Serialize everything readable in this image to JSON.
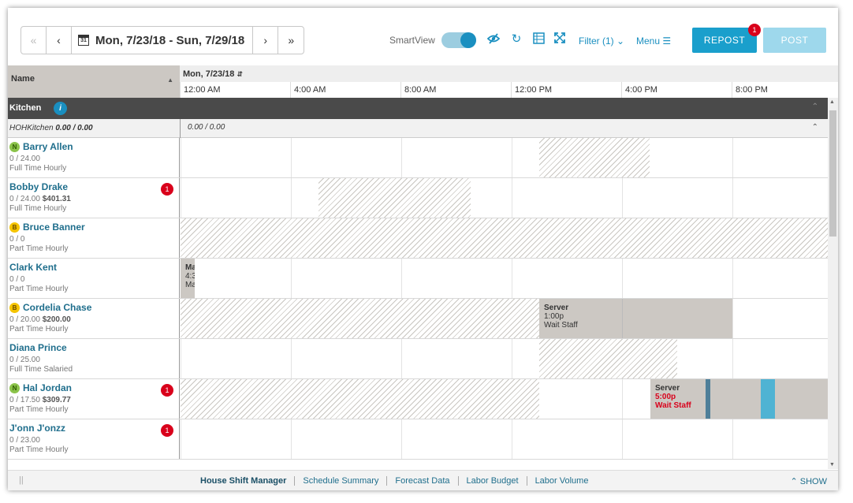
{
  "toolbar": {
    "date_range": "Mon, 7/23/18 - Sun, 7/29/18",
    "calendar_day": "31",
    "smartview_label": "SmartView",
    "filter_label": "Filter (1)",
    "menu_label": "Menu",
    "repost_label": "REPOST",
    "repost_badge": "1",
    "post_label": "POST"
  },
  "grid": {
    "name_header": "Name",
    "date_header": "Mon, 7/23/18",
    "ticks": [
      "12:00 AM",
      "4:00 AM",
      "8:00 AM",
      "12:00 PM",
      "4:00 PM",
      "8:00 PM"
    ]
  },
  "group": {
    "name": "Kitchen",
    "info": "i",
    "sub_label": "HOHKitchen",
    "sub_hours": "0.00 / 0.00",
    "sub_hours_right": "0.00 / 0.00"
  },
  "employees": [
    {
      "name": "Barry Allen",
      "tag": "N",
      "hours": "0 / 24.00",
      "cost": "",
      "type": "Full Time Hourly",
      "badge": ""
    },
    {
      "name": "Bobby Drake",
      "tag": "",
      "hours": "0 / 24.00",
      "cost": "$401.31",
      "type": "Full Time Hourly",
      "badge": "1"
    },
    {
      "name": "Bruce Banner",
      "tag": "B",
      "hours": "0 / 0",
      "cost": "",
      "type": "Part Time Hourly",
      "badge": ""
    },
    {
      "name": "Clark Kent",
      "tag": "",
      "hours": "0 / 0",
      "cost": "",
      "type": "Part Time Hourly",
      "badge": ""
    },
    {
      "name": "Cordelia Chase",
      "tag": "B",
      "hours": "0 / 20.00",
      "cost": "$200.00",
      "type": "Part Time Hourly",
      "badge": ""
    },
    {
      "name": "Diana Prince",
      "tag": "",
      "hours": "0 / 25.00",
      "cost": "",
      "type": "Full Time Salaried",
      "badge": ""
    },
    {
      "name": "Hal Jordan",
      "tag": "N",
      "hours": "0 / 17.50",
      "cost": "$309.77",
      "type": "Part Time Hourly",
      "badge": "1"
    },
    {
      "name": "J'onn J'onzz",
      "tag": "",
      "hours": "0 / 23.00",
      "cost": "",
      "type": "Part Time Hourly",
      "badge": "1"
    }
  ],
  "shifts": {
    "clark": {
      "title": "Ma",
      "time": "4:3",
      "dept": "Ma"
    },
    "cordelia": {
      "title": "Server",
      "time": "1:00p",
      "dept": "Wait Staff"
    },
    "hal": {
      "title": "Server",
      "time": "5:00p",
      "dept": "Wait Staff"
    }
  },
  "footer": {
    "links": [
      "House Shift Manager",
      "Schedule Summary",
      "Forecast Data",
      "Labor Budget",
      "Labor Volume"
    ],
    "show_label": "SHOW"
  },
  "colors": {
    "accent": "#1a9fcc",
    "badge": "#d9001b",
    "group_bar": "#4a4a4a",
    "shift": "#ccc8c3"
  }
}
